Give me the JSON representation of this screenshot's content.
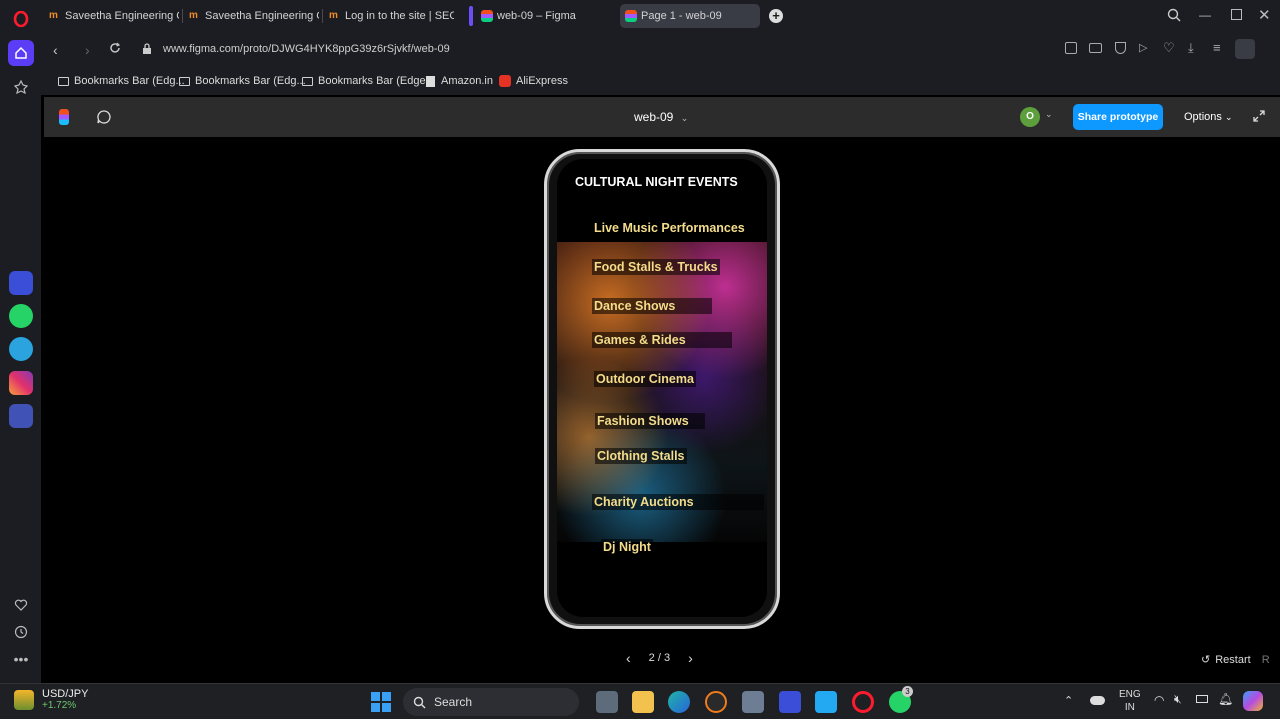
{
  "browser": {
    "tabs": [
      {
        "label": "Saveetha Engineering Col"
      },
      {
        "label": "Saveetha Engineering Col"
      },
      {
        "label": "Log in to the site | SEC"
      },
      {
        "label": "web-09 – Figma"
      },
      {
        "label": "Page 1 - web-09"
      }
    ],
    "url": "www.figma.com/proto/DJWG4HYK8ppG39z6rSjvkf/web-09",
    "bookmarks": [
      {
        "label": "Bookmarks Bar (Edg..."
      },
      {
        "label": "Bookmarks Bar (Edg..."
      },
      {
        "label": "Bookmarks Bar (Edge)"
      },
      {
        "label": "Amazon.in"
      },
      {
        "label": "AliExpress"
      }
    ]
  },
  "figma": {
    "file_name": "web-09",
    "avatar_initial": "O",
    "share_label": "Share prototype",
    "options_label": "Options",
    "accent_color": "#0d99ff"
  },
  "prototype": {
    "title": "CULTURAL NIGHT EVENTS",
    "events": [
      "Live Music Performances",
      "Food Stalls & Trucks",
      "Dance Shows",
      "Games & Rides",
      "Outdoor  Cinema",
      "Fashion Shows",
      "Clothing Stalls",
      "Charity Auctions",
      "Dj Night"
    ],
    "pager": "2 / 3",
    "restart_label": "Restart",
    "restart_key": "R"
  },
  "taskbar": {
    "ticker_symbol": "USD/JPY",
    "ticker_change": "+1.72%",
    "search_placeholder": "Search",
    "lang_top": "ENG",
    "lang_bottom": "IN",
    "whatsapp_badge": "3"
  }
}
